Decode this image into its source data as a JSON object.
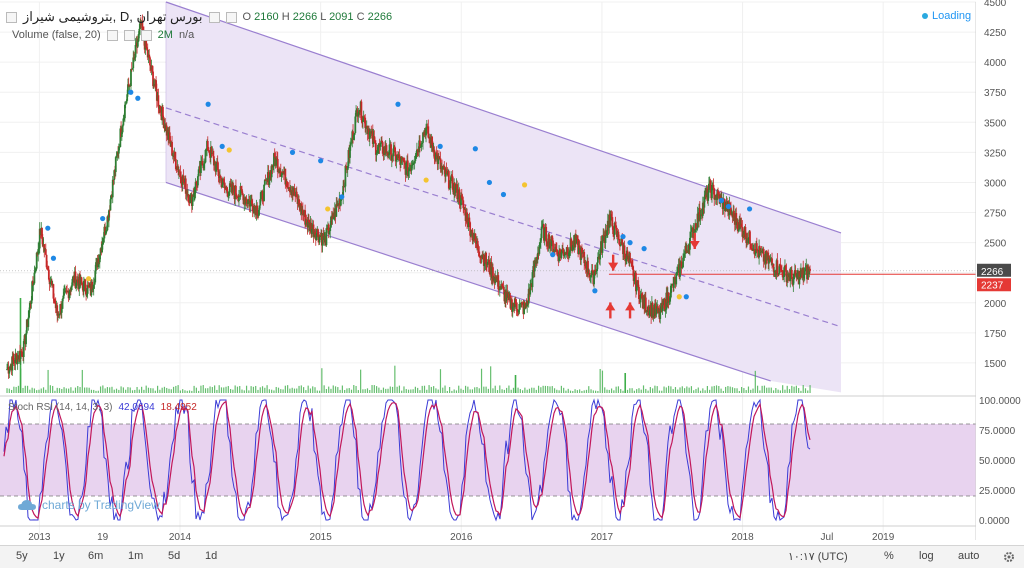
{
  "header": {
    "title": "بتروشیمی شیراز, D, بورس تهران",
    "open_label": "O",
    "open": "2160",
    "high_label": "H",
    "high": "2266",
    "low_label": "L",
    "low": "2091",
    "close_label": "C",
    "close": "2266"
  },
  "volume": {
    "label": "Volume (false, 20)",
    "value": "2M",
    "extra": "n/a"
  },
  "loading": "Loading",
  "rsi": {
    "label": "Stoch RSI (14, 14, 3, 3)",
    "k": "42.0694",
    "d": "18.4952"
  },
  "watermark": "charts by TradingView",
  "price_badges": {
    "last": "2266",
    "line": "2237"
  },
  "colors": {
    "channel_fill": "#ece4f6",
    "channel_line": "#9a7fd0",
    "candle_up": "#2e7d32",
    "candle_down": "#c62828",
    "dot_blue": "#1e88e5",
    "dot_yellow": "#f4c430",
    "rsi_band": "#e8d3ef",
    "rsi_k": "#3b3bd6",
    "rsi_d": "#c2185b",
    "hline": "#e53935",
    "volume": "#3fae4a"
  },
  "chart_data": {
    "type": "line",
    "title": "بتروشیمی شیراز, D, بورس تهران",
    "price_axis": {
      "ylim": [
        1250,
        4500
      ],
      "ticks": [
        "4500",
        "4250",
        "4000",
        "3750",
        "3500",
        "3250",
        "3000",
        "2750",
        "2500",
        "2250",
        "2000",
        "1750",
        "1500"
      ]
    },
    "rsi_axis": {
      "ylim": [
        0,
        100
      ],
      "ticks": [
        "100.0000",
        "75.0000",
        "50.0000",
        "25.0000",
        "0.0000"
      ],
      "bands": [
        20,
        80
      ]
    },
    "time_axis": {
      "labels": [
        "2013",
        "19",
        "2014",
        "2015",
        "2016",
        "2017",
        "2018",
        "Jul",
        "2019"
      ]
    },
    "series": [
      {
        "values": [
          1450,
          1620,
          2600,
          1900,
          2200,
          2100,
          2700,
          3600,
          4300,
          3700,
          3200,
          2850,
          3300,
          2950,
          2900,
          2780,
          3200,
          2950,
          2650,
          2520,
          2900,
          3650,
          3300,
          3250,
          3100,
          3450,
          3100,
          2900,
          2500,
          2250,
          2000,
          1950,
          2600,
          2400,
          2500,
          2200,
          2700,
          2400,
          2000,
          1900,
          2200,
          2600,
          2950,
          2800,
          2600,
          2400,
          2300,
          2200,
          2266
        ]
      }
    ],
    "channel": {
      "upper": [
        [
          2013.9,
          4500
        ],
        [
          2018.7,
          2580
        ]
      ],
      "lower": [
        [
          2013.9,
          3000
        ],
        [
          2018.2,
          1350
        ]
      ],
      "middle": [
        [
          2013.9,
          3620
        ],
        [
          2018.7,
          1800
        ]
      ]
    },
    "horizontal_line": 2237,
    "grid": true,
    "legend": "none"
  },
  "toolbar": {
    "ranges": [
      "5y",
      "1y",
      "6m",
      "1m",
      "5d",
      "1d"
    ],
    "time": "۱۰:۱۷ (UTC)",
    "percent": "%",
    "log": "log",
    "auto": "auto"
  }
}
